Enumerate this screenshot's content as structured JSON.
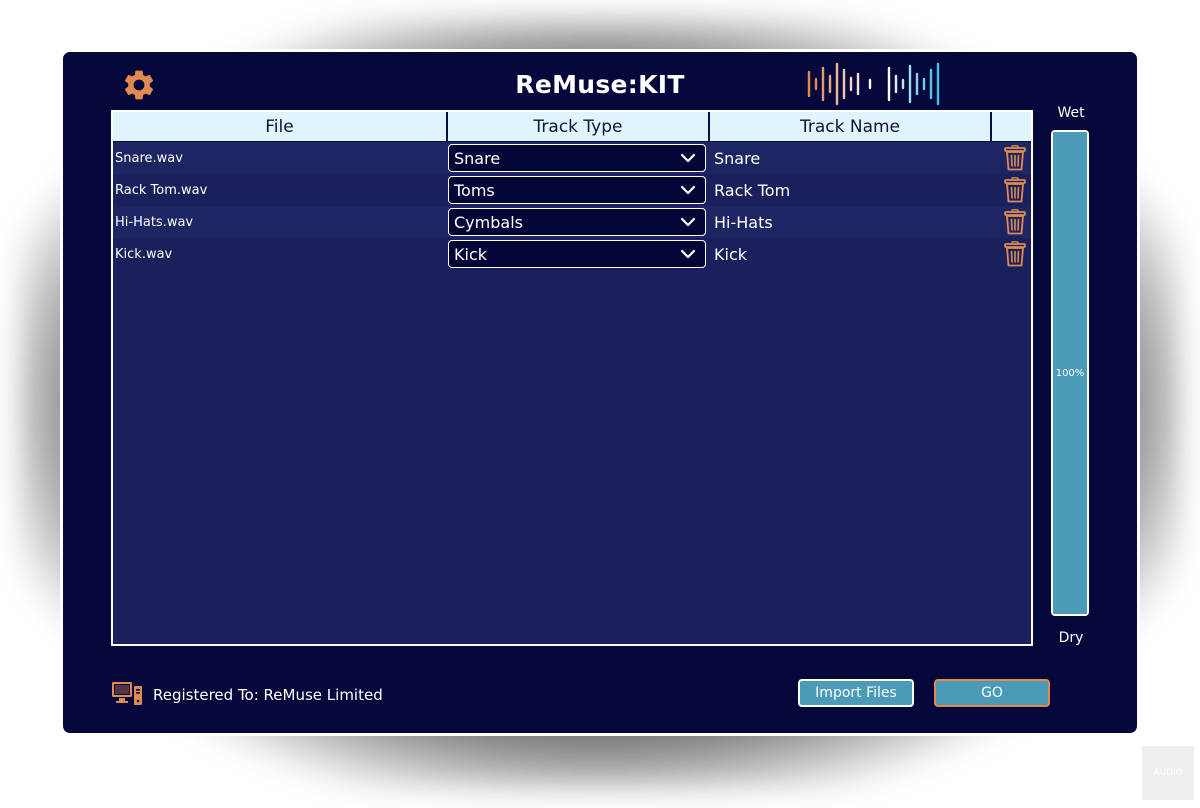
{
  "app": {
    "title": "ReMuse:KIT"
  },
  "table": {
    "headers": {
      "file": "File",
      "type": "Track Type",
      "name": "Track Name"
    },
    "rows": [
      {
        "file": "Snare.wav",
        "type": "Snare",
        "name": "Snare"
      },
      {
        "file": "Rack Tom.wav",
        "type": "Toms",
        "name": "Rack Tom"
      },
      {
        "file": "Hi-Hats.wav",
        "type": "Cymbals",
        "name": "Hi-Hats"
      },
      {
        "file": "Kick.wav",
        "type": "Kick",
        "name": "Kick"
      }
    ]
  },
  "mix": {
    "wet_label": "Wet",
    "dry_label": "Dry",
    "value_label": "100%",
    "value": 1.0
  },
  "footer": {
    "registered_text": "Registered To: ReMuse Limited",
    "import_label": "Import Files",
    "go_label": "GO"
  },
  "watermark": {
    "text": "AUDIO"
  },
  "colors": {
    "background": "#06073a",
    "table": "#1a205c",
    "header": "#dff4fb",
    "accent_orange": "#e08a50",
    "accent_blue": "#4a9ab8",
    "wave_cyan": "#56c7ea"
  },
  "icons": {
    "settings": "gear-icon",
    "delete": "trash-icon",
    "dropdown": "chevron-down-icon",
    "registration": "computer-icon",
    "logo": "waveform-icon"
  }
}
